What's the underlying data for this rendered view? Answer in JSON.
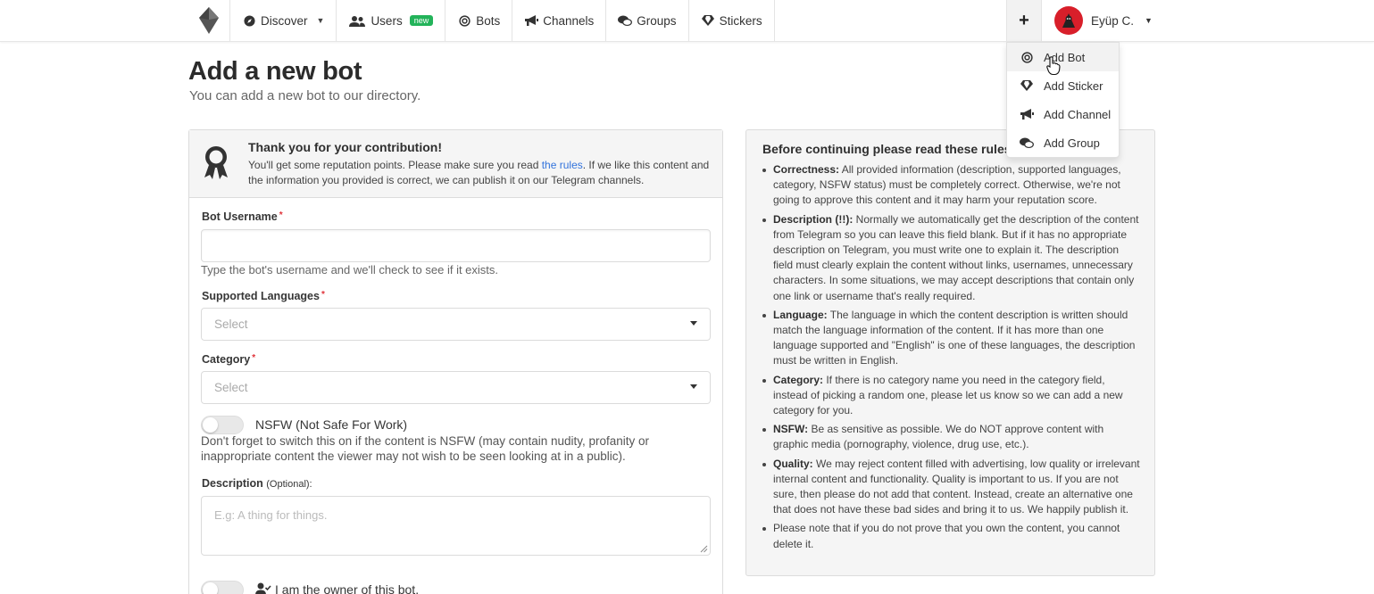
{
  "nav": {
    "items": [
      {
        "label": "Discover",
        "icon": "compass-icon"
      },
      {
        "label": "Users",
        "icon": "users-icon",
        "badge": "new"
      },
      {
        "label": "Bots",
        "icon": "bot-icon"
      },
      {
        "label": "Channels",
        "icon": "megaphone-icon"
      },
      {
        "label": "Groups",
        "icon": "comments-icon"
      },
      {
        "label": "Stickers",
        "icon": "gem-icon"
      }
    ],
    "plus_label": "+",
    "user_name": "Eyüp C."
  },
  "dropdown": {
    "items": [
      {
        "label": "Add Bot",
        "icon": "bot-icon"
      },
      {
        "label": "Add Sticker",
        "icon": "gem-icon"
      },
      {
        "label": "Add Channel",
        "icon": "megaphone-icon"
      },
      {
        "label": "Add Group",
        "icon": "comments-icon"
      }
    ]
  },
  "page": {
    "title": "Add a new bot",
    "subtitle": "You can add a new bot to our directory."
  },
  "notice": {
    "title": "Thank you for your contribution!",
    "text_before": "You'll get some reputation points. Please make sure you read ",
    "link": "the rules",
    "text_after": ". If we like this content and the information you provided is correct, we can publish it on our Telegram channels."
  },
  "form": {
    "username_label": "Bot Username",
    "required_mark": "*",
    "username_help": "Type the bot's username and we'll check to see if it exists.",
    "languages_label": "Supported Languages",
    "languages_placeholder": "Select",
    "category_label": "Category",
    "category_placeholder": "Select",
    "nsfw_label": "NSFW (Not Safe For Work)",
    "nsfw_help": "Don't forget to switch this on if the content is NSFW (may contain nudity, profanity or inappropriate content the viewer may not wish to be seen looking at in a public).",
    "description_label": "Description",
    "description_optional": "(Optional):",
    "description_placeholder": "E.g: A thing for things.",
    "owner_label": "I am the owner of this bot."
  },
  "rules": {
    "title": "Before continuing please read these rules",
    "items": [
      {
        "term": "Correctness:",
        "text": " All provided information (description, supported languages, category, NSFW status) must be completely correct. Otherwise, we're not going to approve this content and it may harm your reputation score."
      },
      {
        "term": "Description (!!):",
        "text": " Normally we automatically get the description of the content from Telegram so you can leave this field blank. But if it has no appropriate description on Telegram, you must write one to explain it. The description field must clearly explain the content without links, usernames, unnecessary characters. In some situations, we may accept descriptions that contain only one link or username that's really required."
      },
      {
        "term": "Language:",
        "text": " The language in which the content description is written should match the language information of the content. If it has more than one language supported and \"English\" is one of these languages, the description must be written in English."
      },
      {
        "term": "Category:",
        "text": " If there is no category name you need in the category field, instead of picking a random one, please let us know so we can add a new category for you."
      },
      {
        "term": "NSFW:",
        "text": " Be as sensitive as possible. We do NOT approve content with graphic media (pornography, violence, drug use, etc.)."
      },
      {
        "term": "Quality:",
        "text": " We may reject content filled with advertising, low quality or irrelevant internal content and functionality. Quality is important to us. If you are not sure, then please do not add that content. Instead, create an alternative one that does not have these bad sides and bring it to us. We happily publish it."
      },
      {
        "term": "",
        "text": "Please note that if you do not prove that you own the content, you cannot delete it."
      }
    ]
  }
}
